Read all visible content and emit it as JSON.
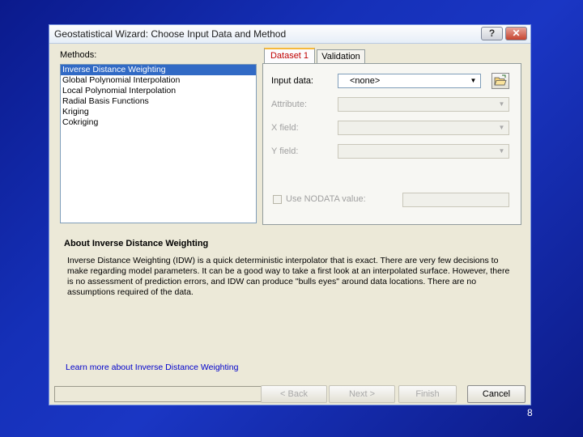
{
  "window": {
    "title": "Geostatistical Wizard: Choose Input Data and Method",
    "help_label": "?",
    "close_label": "✕"
  },
  "methods": {
    "label": "Methods:",
    "items": [
      {
        "label": "Inverse Distance Weighting",
        "selected": true
      },
      {
        "label": "Global Polynomial Interpolation",
        "selected": false
      },
      {
        "label": "Local Polynomial Interpolation",
        "selected": false
      },
      {
        "label": "Radial Basis Functions",
        "selected": false
      },
      {
        "label": "Kriging",
        "selected": false
      },
      {
        "label": "Cokriging",
        "selected": false
      }
    ]
  },
  "tabs": [
    {
      "label": "Dataset 1",
      "active": true
    },
    {
      "label": "Validation",
      "active": false
    }
  ],
  "dataset": {
    "input_data_label": "Input data:",
    "input_data_value": "<none>",
    "attribute_label": "Attribute:",
    "x_field_label": "X field:",
    "y_field_label": "Y field:",
    "nodata_label": "Use NODATA value:",
    "nodata_checked": false,
    "nodata_value": ""
  },
  "about": {
    "title": "About Inverse Distance Weighting",
    "text": "Inverse Distance Weighting (IDW) is a quick deterministic interpolator that is exact. There are very few decisions to make regarding model parameters. It can be a good way to take a first look at an interpolated surface. However, there is no assessment of prediction errors, and IDW can produce \"bulls eyes\" around data locations. There are no assumptions required of the data.",
    "link": "Learn more about Inverse Distance Weighting"
  },
  "buttons": {
    "back": "< Back",
    "next": "Next >",
    "finish": "Finish",
    "cancel": "Cancel"
  },
  "slide": {
    "page_number": "8"
  },
  "colors": {
    "background": "#1530b8",
    "selection": "#316ac5",
    "link": "#0000cc",
    "active_tab_text": "#c00000"
  }
}
